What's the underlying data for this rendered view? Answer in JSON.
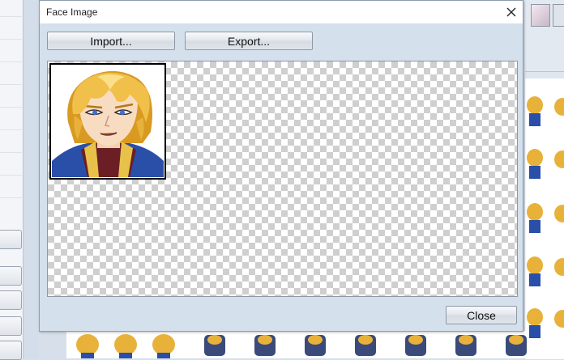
{
  "dialog": {
    "title": "Face Image",
    "buttons": {
      "import_label": "Import...",
      "export_label": "Export...",
      "close_label": "Close"
    },
    "faces": [
      {
        "description_icon": "blond-hero-face"
      }
    ]
  },
  "colors": {
    "dialog_body": "#d5e0ed",
    "border": "#8e97a3",
    "checker_light": "#ffffff",
    "checker_dark": "#cfcfcf",
    "hair": "#e8b23a",
    "armor_blue": "#2a4fa8"
  },
  "icons": {
    "close": "close-icon",
    "face": "character-face-icon"
  }
}
